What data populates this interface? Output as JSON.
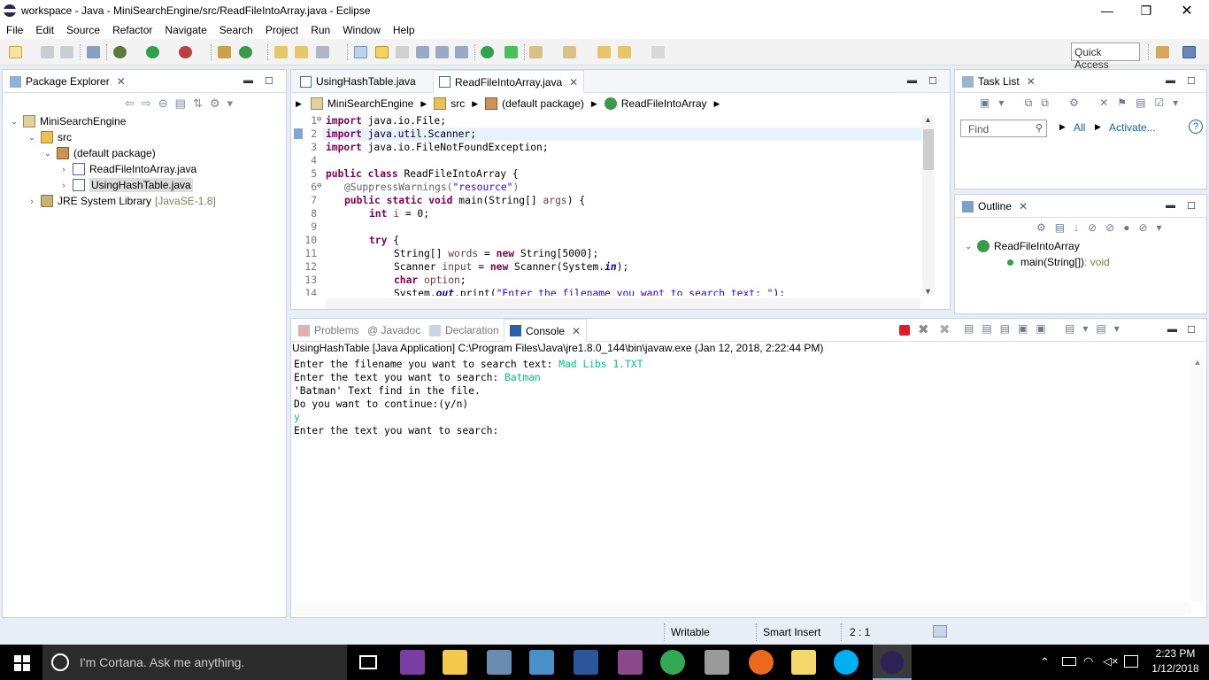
{
  "window": {
    "title": "workspace - Java - MiniSearchEngine/src/ReadFileIntoArray.java - Eclipse",
    "controls": {
      "minimize": "—",
      "restore": "❐",
      "close": "✕"
    }
  },
  "menu": [
    "File",
    "Edit",
    "Source",
    "Refactor",
    "Navigate",
    "Search",
    "Project",
    "Run",
    "Window",
    "Help"
  ],
  "toolbar": {
    "quick_access": "Quick Access"
  },
  "package_explorer": {
    "tab_label": "Package Explorer",
    "tree": [
      {
        "label": "MiniSearchEngine",
        "icon": "project-icon"
      },
      {
        "label": "src",
        "icon": "source-folder-icon"
      },
      {
        "label": "(default package)",
        "icon": "package-icon"
      },
      {
        "label": "ReadFileIntoArray.java",
        "icon": "java-file-icon"
      },
      {
        "label": "UsingHashTable.java",
        "icon": "java-file-icon",
        "selected": true
      },
      {
        "label": "JRE System Library",
        "suffix": "[JavaSE-1.8]",
        "icon": "library-icon"
      }
    ]
  },
  "editor": {
    "tabs": [
      {
        "label": "UsingHashTable.java",
        "active": false
      },
      {
        "label": "ReadFileIntoArray.java",
        "active": true
      }
    ],
    "breadcrumb": [
      "MiniSearchEngine",
      "src",
      "(default package)",
      "ReadFileIntoArray"
    ],
    "line_numbers": [
      "1",
      "2",
      "3",
      "4",
      "5",
      "6",
      "7",
      "8",
      "9",
      "10",
      "11",
      "12",
      "13",
      "14"
    ],
    "code": {
      "l1": {
        "kw": "import",
        "rest": " java.io.File;"
      },
      "l2": {
        "kw": "import",
        "rest": " java.util.Scanner;"
      },
      "l3": {
        "kw": "import",
        "rest": " java.io.FileNotFoundException;"
      },
      "l5": {
        "kw1": "public",
        "kw2": "class",
        "rest": " ReadFileIntoArray {"
      },
      "l6": {
        "ann": "@SuppressWarnings(",
        "str": "\"resource\"",
        "end": ")"
      },
      "l7": {
        "kw1": "public",
        "kw2": "static",
        "kw3": "void",
        "rest": " main(String[] ",
        "var": "args",
        "end": ") {"
      },
      "l8": {
        "kw": "int",
        "var": " i",
        "rest": " = 0;"
      },
      "l10": {
        "kw": "try",
        "rest": " {"
      },
      "l11": {
        "pre": "String[] ",
        "var": "words",
        "mid": " = ",
        "kw": "new",
        "rest": " String[5000];"
      },
      "l12": {
        "pre": "Scanner ",
        "var": "input",
        "mid": " = ",
        "kw": "new",
        "rest": " Scanner(System.",
        "fld": "in",
        "end": ");"
      },
      "l13": {
        "kw": "char",
        "var": " option",
        "rest": ";"
      },
      "l14": {
        "pre": "System.",
        "fld": "out",
        "mid": ".print(",
        "str": "\"Enter the filename you want to search text: \"",
        "end": ");"
      }
    }
  },
  "task_list": {
    "tab_label": "Task List",
    "find_placeholder": "Find",
    "all": "All",
    "activate": "Activate..."
  },
  "outline": {
    "tab_label": "Outline",
    "class_name": "ReadFileIntoArray",
    "method_name": "main(String[])",
    "method_type": " : void"
  },
  "bottom_panel": {
    "tabs": [
      "Problems",
      "@ Javadoc",
      "Declaration",
      "Console"
    ],
    "console_header": "UsingHashTable [Java Application] C:\\Program Files\\Java\\jre1.8.0_144\\bin\\javaw.exe (Jan 12, 2018, 2:22:44 PM)",
    "lines": [
      {
        "out": "Enter the filename you want to search text: ",
        "in": "Mad Libs 1.TXT"
      },
      {
        "out": "Enter the text you want to search: ",
        "in": "Batman"
      },
      {
        "out": "'Batman' Text find in the file.",
        "in": ""
      },
      {
        "out": "Do you want to continue:(y/n)",
        "in": ""
      },
      {
        "out": "",
        "in": "y"
      },
      {
        "out": "Enter the text you want to search:",
        "in": ""
      }
    ]
  },
  "status": {
    "writable": "Writable",
    "insert_mode": "Smart Insert",
    "position": "2 : 1"
  },
  "taskbar": {
    "cortana": "I'm Cortana. Ask me anything.",
    "time": "2:23 PM",
    "date": "1/12/2018"
  },
  "colors": {
    "keyword": "#7f0055",
    "string": "#2a00ff",
    "console_input": "#00c87d",
    "panel_border": "#c7d3e0"
  }
}
